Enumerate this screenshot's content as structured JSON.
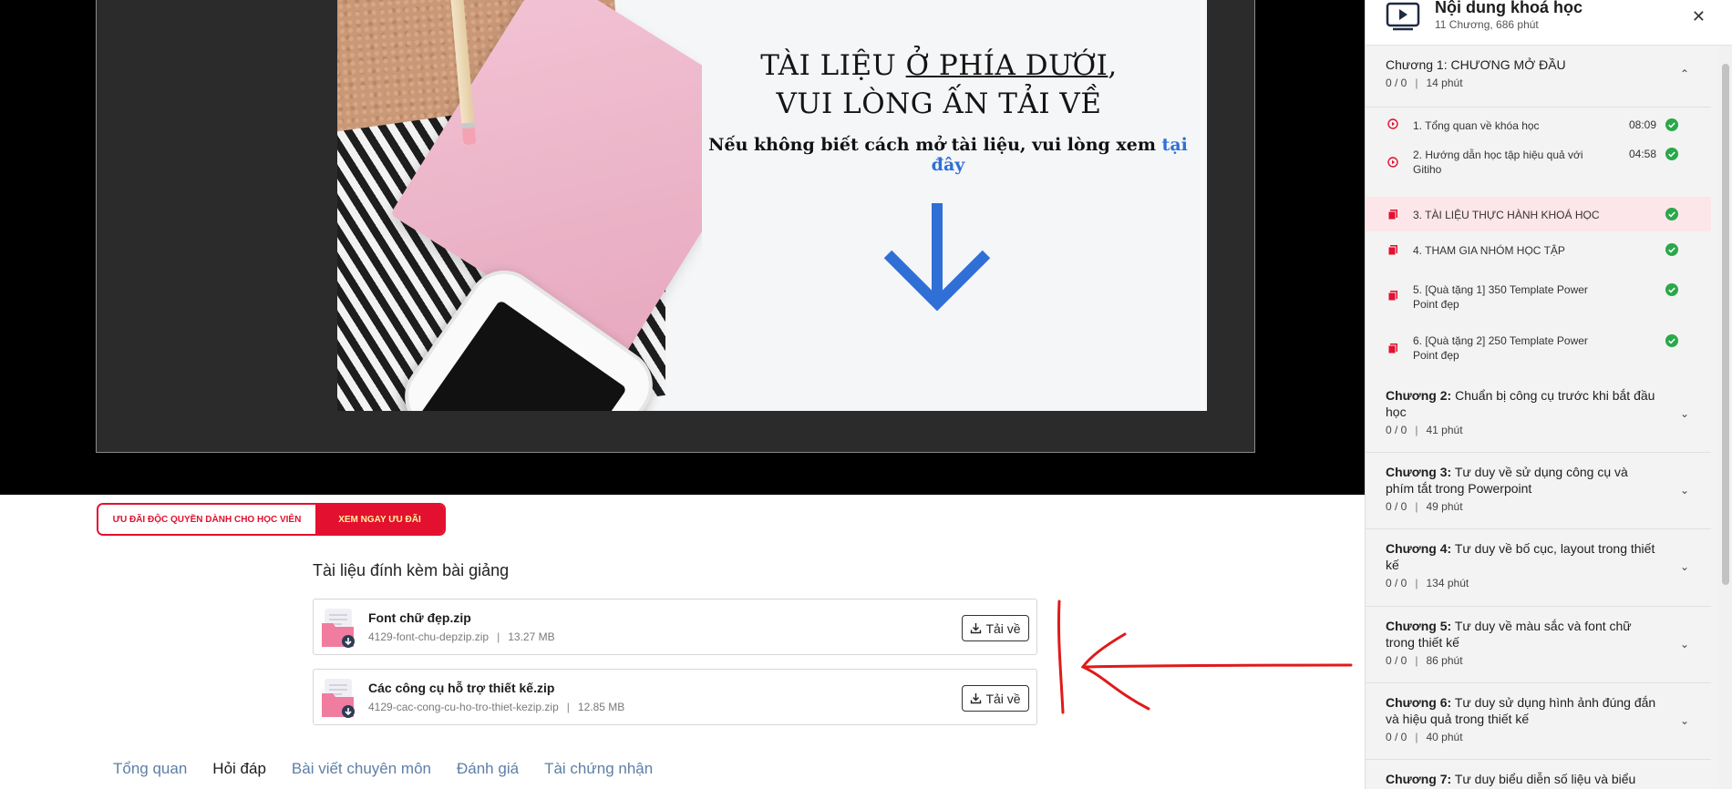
{
  "slide": {
    "title_pre": "TÀI LIỆU ",
    "title_underlined": "Ở PHÍA DƯỚI",
    "title_comma": ",",
    "title_line2": "VUI LÒNG ẤN TẢI VỀ",
    "subtitle_pre": "Nếu không biết cách mở tài liệu, vui lòng xem ",
    "subtitle_link": "tại đây",
    "arrow_color": "#2f6fd6"
  },
  "promo": {
    "left_label": "ƯU ĐÃI ĐỘC QUYỀN DÀNH CHO HỌC VIÊN",
    "right_label": "XEM NGAY ƯU ĐÃI",
    "accent": "#e3102f"
  },
  "attachments": {
    "title": "Tài liệu đính kèm bài giảng",
    "download_label": "Tải về",
    "files": [
      {
        "name": "Font chữ đẹp.zip",
        "filename": "4129-font-chu-depzip.zip",
        "size": "13.27 MB"
      },
      {
        "name": "Các công cụ hỗ trợ thiết kế.zip",
        "filename": "4129-cac-cong-cu-ho-tro-thiet-kezip.zip",
        "size": "12.85 MB"
      }
    ]
  },
  "tabs": [
    "Tổng quan",
    "Hỏi đáp",
    "Bài viết chuyên môn",
    "Đánh giá",
    "Tài chứng nhận"
  ],
  "active_tab": "Hỏi đáp",
  "sidebar": {
    "title": "Nội dung khoá học",
    "subtitle": "11 Chương, 686 phút",
    "close": "✕",
    "chapters": [
      {
        "label": "Chương 1:",
        "name": "CHƯƠNG MỞ ĐẦU",
        "progress": "0 / 0",
        "duration": "14 phút",
        "expanded": true
      },
      {
        "label": "Chương 2:",
        "name": "Chuẩn bị công cụ trước khi bắt đầu học",
        "progress": "0 / 0",
        "duration": "41 phút"
      },
      {
        "label": "Chương 3:",
        "name": "Tư duy về sử dụng công cụ và phím tắt trong Powerpoint",
        "progress": "0 / 0",
        "duration": "49 phút"
      },
      {
        "label": "Chương 4:",
        "name": "Tư duy về bố cục, layout trong thiết kế",
        "progress": "0 / 0",
        "duration": "134 phút"
      },
      {
        "label": "Chương 5:",
        "name": "Tư duy về màu sắc và font chữ trong thiết kế",
        "progress": "0 / 0",
        "duration": "86 phút"
      },
      {
        "label": "Chương 6:",
        "name": "Tư duy sử dụng hình ảnh đúng đắn và hiệu quả trong thiết kế",
        "progress": "0 / 0",
        "duration": "40 phút"
      },
      {
        "label": "Chương 7:",
        "name": "Tư duy biểu diễn số liệu và biểu",
        "progress": "",
        "duration": ""
      }
    ],
    "lessons": [
      {
        "title": "1. Tổng quan về khóa học",
        "time": "08:09",
        "type": "video",
        "done": true
      },
      {
        "title": "2. Hướng dẫn học tập hiệu quả với Gitiho",
        "time": "04:58",
        "type": "video",
        "done": true
      },
      {
        "title": "3. TÀI LIỆU THỰC HÀNH KHOÁ HỌC",
        "time": "",
        "type": "doc",
        "done": true,
        "active": true
      },
      {
        "title": "4. THAM GIA NHÓM HỌC TẬP",
        "time": "",
        "type": "doc",
        "done": true
      },
      {
        "title": "5. [Quà tặng 1] 350 Template Power Point đẹp",
        "time": "",
        "type": "doc",
        "done": true
      },
      {
        "title": "6. [Quà tặng 2] 250 Template Power Point đẹp",
        "time": "",
        "type": "doc",
        "done": true
      }
    ],
    "colors": {
      "check": "#2aa84a",
      "lesson_icon": "#e3102f"
    }
  }
}
